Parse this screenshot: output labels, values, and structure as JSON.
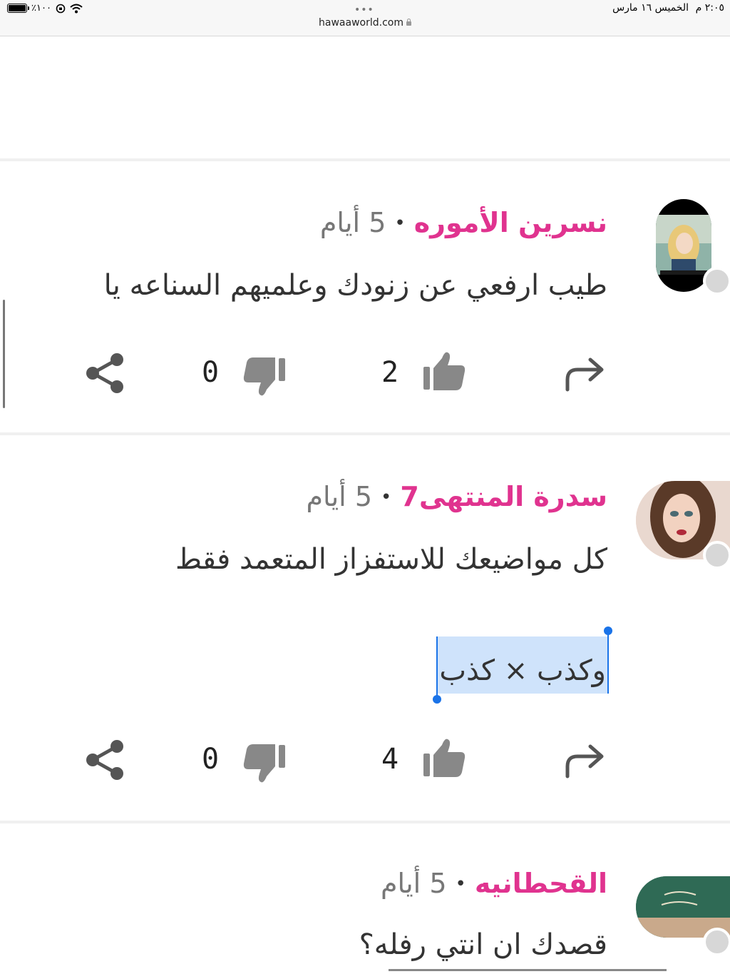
{
  "status_bar": {
    "time": "٢:٠٥ م",
    "date": "الخميس ١٦ مارس",
    "battery": "٪١٠٠",
    "url": "hawaaworld.com"
  },
  "comments": [
    {
      "author": "نسرين الأموره",
      "time": "5 أيام",
      "body_lines": [
        "طيب ارفعي عن زنودك وعلميهم السناعه يا"
      ],
      "likes": "2",
      "dislikes": "0"
    },
    {
      "author": "سدرة المنتهى7",
      "time": "5 أيام",
      "body_lines": [
        "كل مواضيعك للاستفزاز المتعمد فقط",
        "وكذب × كذب"
      ],
      "likes": "4",
      "dislikes": "0"
    },
    {
      "author": "القحطانيه",
      "time": "5 أيام",
      "body_lines": [
        "قصدك ان انتي رفله؟"
      ]
    }
  ],
  "colors": {
    "author": "#e0338f",
    "icons": "#888888",
    "selection": "#cfe3fb",
    "selection_handle": "#1a73e8"
  },
  "icons": [
    "reply-icon",
    "thumbs-up-icon",
    "thumbs-down-icon",
    "share-icon"
  ]
}
